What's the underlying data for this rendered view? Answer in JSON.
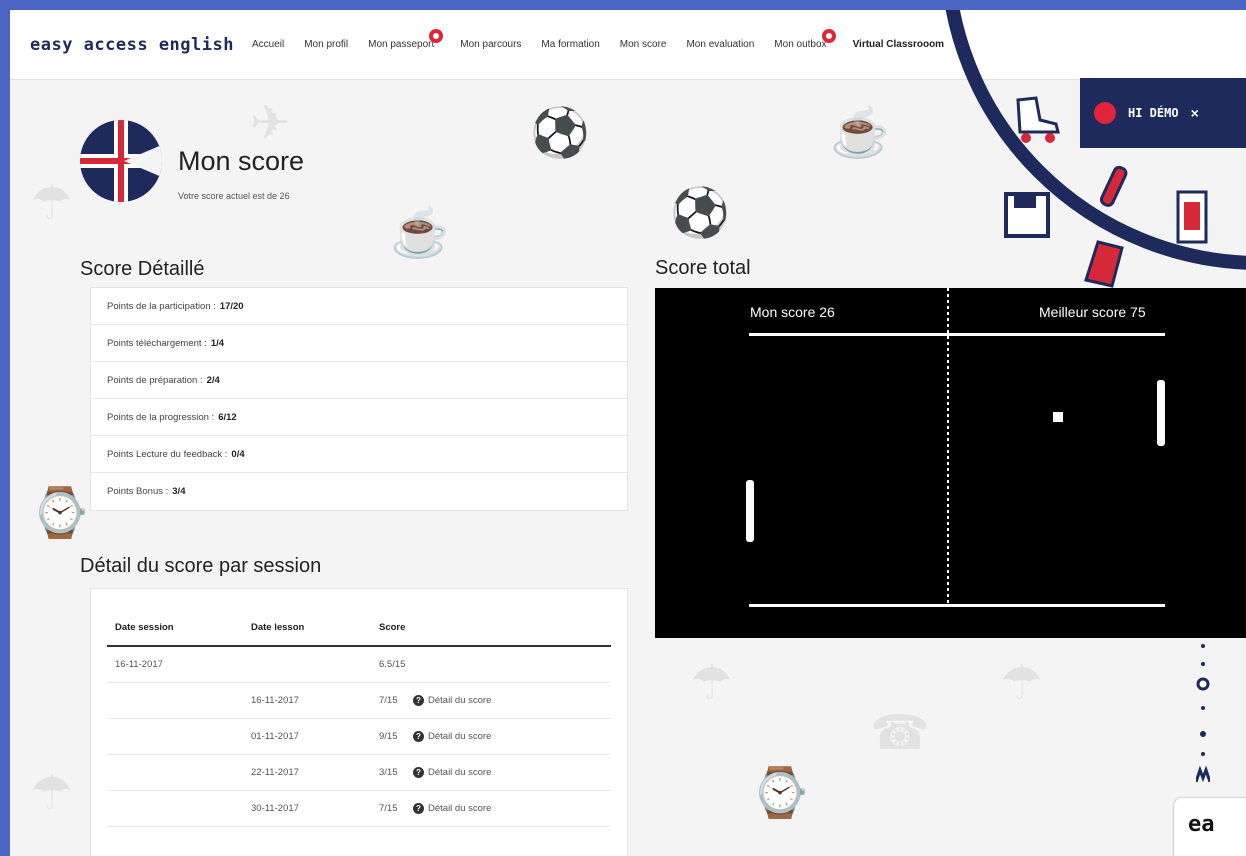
{
  "brand": "easy access english",
  "nav": {
    "items": [
      {
        "label": "Accueil"
      },
      {
        "label": "Mon profil"
      },
      {
        "label": "Mon passeport",
        "badge": true
      },
      {
        "label": "Mon parcours"
      },
      {
        "label": "Ma formation"
      },
      {
        "label": "Mon score"
      },
      {
        "label": "Mon evaluation"
      },
      {
        "label": "Mon outbox",
        "badge": true
      },
      {
        "label": "Virtual Classrooom",
        "bold": true
      }
    ]
  },
  "header": {
    "title": "Mon score",
    "subtitle": "Votre score actuel est de 26"
  },
  "detail": {
    "title": "Score Détaillé",
    "items": [
      {
        "label": "Points de la participation :",
        "value": "17/20"
      },
      {
        "label": "Points téléchargement :",
        "value": "1/4"
      },
      {
        "label": "Points de préparation :",
        "value": "2/4"
      },
      {
        "label": "Points de la progression :",
        "value": "6/12"
      },
      {
        "label": "Points Lecture du feedback :",
        "value": "0/4"
      },
      {
        "label": "Points Bonus :",
        "value": "3/4"
      }
    ]
  },
  "sessions": {
    "title": "Détail du score par session",
    "headers": [
      "Date session",
      "Date lesson",
      "Score"
    ],
    "rows": [
      {
        "session": "16-11-2017",
        "lesson": "",
        "score": "6.5/15",
        "link": ""
      },
      {
        "session": "",
        "lesson": "16-11-2017",
        "score": "7/15",
        "link": "Détail du score"
      },
      {
        "session": "",
        "lesson": "01-11-2017",
        "score": "9/15",
        "link": "Détail du score"
      },
      {
        "session": "",
        "lesson": "22-11-2017",
        "score": "3/15",
        "link": "Détail du score"
      },
      {
        "session": "",
        "lesson": "30-11-2017",
        "score": "7/15",
        "link": "Détail du score"
      }
    ]
  },
  "total": {
    "title": "Score total",
    "my_score": "Mon score 26",
    "best_score": "Meilleur score 75"
  },
  "demo": {
    "label": "HI DÉMO",
    "close": "×"
  },
  "corner_brand": "ea",
  "icons": {
    "q_icon": "?"
  },
  "colors": {
    "navy": "#1e2a5c",
    "red": "#e0243a",
    "page_bg": "#4a64c4"
  }
}
